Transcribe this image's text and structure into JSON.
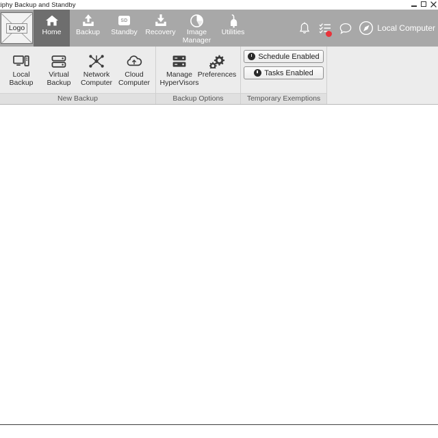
{
  "window": {
    "title": "ctiphy Backup and Standby",
    "controls": {
      "minimize": "minimize",
      "maximize": "maximize",
      "close": "close"
    }
  },
  "logo": {
    "label": "Logo"
  },
  "tabs": [
    {
      "label": "Home",
      "icon": "home-icon",
      "active": true
    },
    {
      "label": "Backup",
      "icon": "upload-icon",
      "active": false
    },
    {
      "label": "Standby",
      "icon": "sd-card-icon",
      "active": false
    },
    {
      "label": "Recovery",
      "icon": "download-icon",
      "active": false
    },
    {
      "label": "Image Manager",
      "icon": "pie-chart-icon",
      "active": false
    },
    {
      "label": "Utilities",
      "icon": "utility-lamp-icon",
      "active": false
    }
  ],
  "header_right": {
    "icons": [
      {
        "name": "bell-icon",
        "badge": ""
      },
      {
        "name": "task-list-icon",
        "badge": ""
      },
      {
        "name": "chat-icon",
        "badge": ""
      }
    ],
    "connection": {
      "icon": "navigation-compass-icon",
      "label": "Local Computer"
    }
  },
  "ribbon": {
    "groups": [
      {
        "title": "New Backup",
        "buttons": [
          {
            "label": "Local Backup",
            "icon": "desktop-computer-icon"
          },
          {
            "label": "Virtual Backup",
            "icon": "server-stack-icon"
          },
          {
            "label": "Network Computer",
            "icon": "network-nodes-icon"
          },
          {
            "label": "Cloud Computer",
            "icon": "cloud-icon"
          }
        ]
      },
      {
        "title": "Backup Options",
        "buttons": [
          {
            "label": "Manage HyperVisors",
            "icon": "server-rack-icon"
          },
          {
            "label": "Preferences",
            "icon": "gears-icon"
          }
        ]
      },
      {
        "title": "Temporary Exemptions",
        "toggles": [
          {
            "label": "Schedule Enabled",
            "icon": "power-toggle-icon"
          },
          {
            "label": "Tasks Enabled",
            "icon": "power-toggle-icon"
          }
        ]
      }
    ]
  },
  "content": {
    "body_text": ""
  },
  "statusbar": {
    "text": ""
  },
  "colors": {
    "tabstrip_bg": "#a8a8a8",
    "active_tab_bg": "#6e6e6e",
    "ribbon_bg": "#ececec",
    "group_title_bg": "#e0e0e0",
    "badge_red": "#e8333a",
    "content_bg": "#ffffff"
  }
}
